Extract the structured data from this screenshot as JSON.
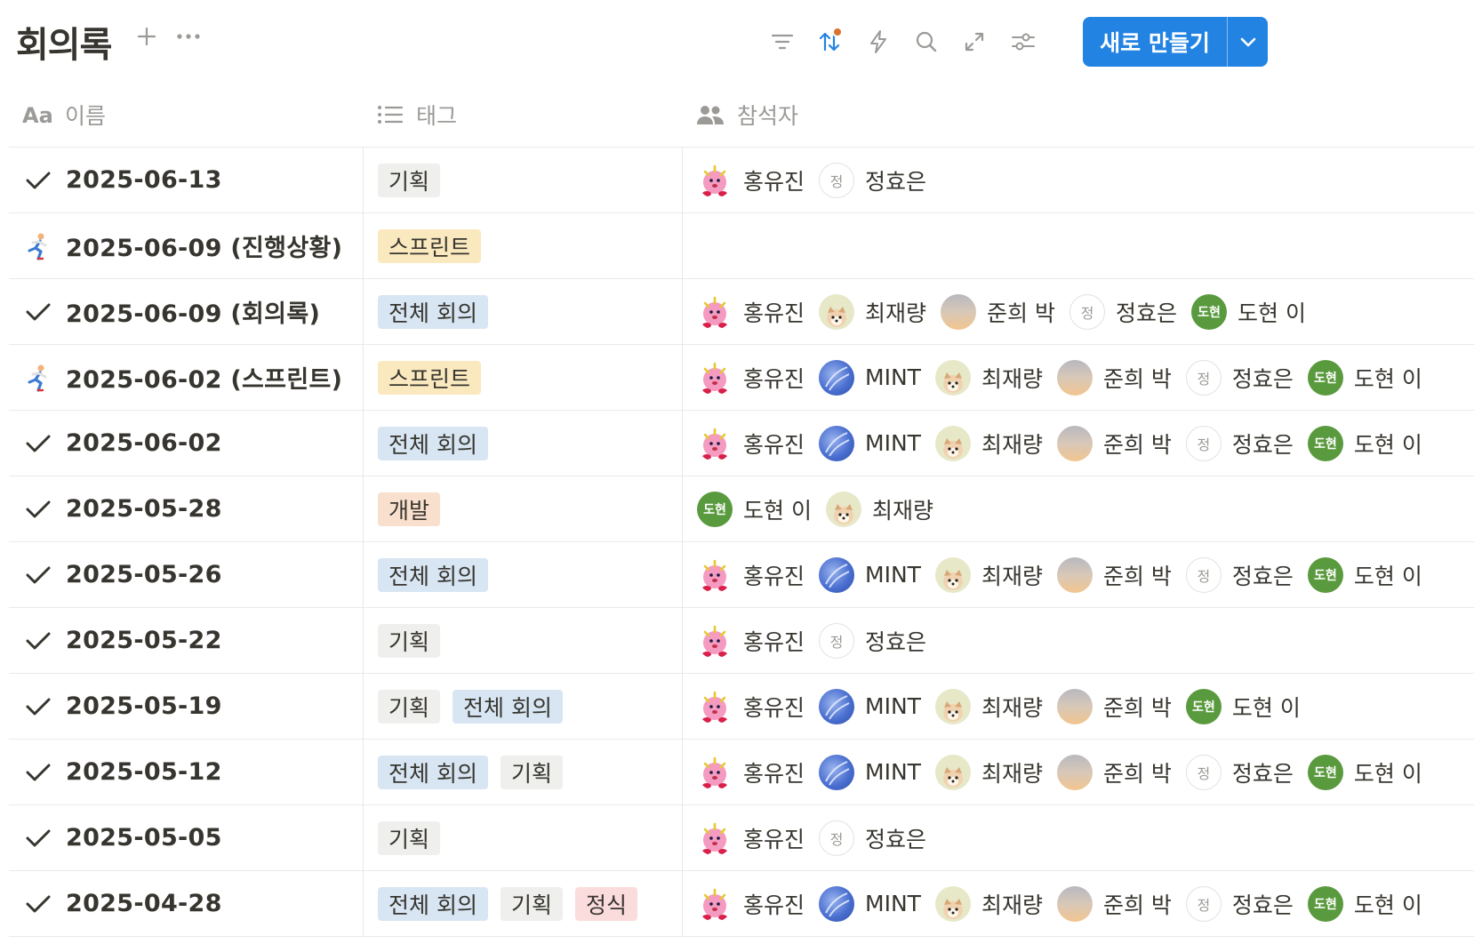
{
  "header": {
    "title": "회의록",
    "new_button_label": "새로 만들기",
    "toolbar_icons": [
      "filter-icon",
      "sort-icon",
      "automation-icon",
      "search-icon",
      "expand-icon",
      "settings-icon"
    ]
  },
  "columns": [
    {
      "label": "이름",
      "icon": "text-type-icon"
    },
    {
      "label": "태그",
      "icon": "list-icon"
    },
    {
      "label": "참석자",
      "icon": "people-icon"
    }
  ],
  "colors": {
    "accent": "#2383e2",
    "sort_badge": "#d9732c",
    "tag_planning": "#efefed",
    "tag_sprint": "#fae9bf",
    "tag_all_hands": "#d8e6f3",
    "tag_dev": "#f9dfcd",
    "tag_formal": "#fbdcdc"
  },
  "rows": [
    {
      "icon": "check",
      "name": "2025-06-13",
      "tags": [
        "기획"
      ],
      "people": [
        "홍유진",
        "정효은"
      ]
    },
    {
      "icon": "runner",
      "name": "2025-06-09 (진행상황)",
      "tags": [
        "스프린트"
      ],
      "people": []
    },
    {
      "icon": "check",
      "name": "2025-06-09 (회의록)",
      "tags": [
        "전체 회의"
      ],
      "people": [
        "홍유진",
        "최재량",
        "준희 박",
        "정효은",
        "도현 이"
      ]
    },
    {
      "icon": "runner",
      "name": "2025-06-02 (스프린트)",
      "tags": [
        "스프린트"
      ],
      "people": [
        "홍유진",
        "MINT",
        "최재량",
        "준희 박",
        "정효은",
        "도현 이"
      ]
    },
    {
      "icon": "check",
      "name": "2025-06-02",
      "tags": [
        "전체 회의"
      ],
      "people": [
        "홍유진",
        "MINT",
        "최재량",
        "준희 박",
        "정효은",
        "도현 이"
      ]
    },
    {
      "icon": "check",
      "name": "2025-05-28",
      "tags": [
        "개발"
      ],
      "people": [
        "도현 이",
        "최재량"
      ]
    },
    {
      "icon": "check",
      "name": "2025-05-26",
      "tags": [
        "전체 회의"
      ],
      "people": [
        "홍유진",
        "MINT",
        "최재량",
        "준희 박",
        "정효은",
        "도현 이"
      ]
    },
    {
      "icon": "check",
      "name": "2025-05-22",
      "tags": [
        "기획"
      ],
      "people": [
        "홍유진",
        "정효은"
      ]
    },
    {
      "icon": "check",
      "name": "2025-05-19",
      "tags": [
        "기획",
        "전체 회의"
      ],
      "people": [
        "홍유진",
        "MINT",
        "최재량",
        "준희 박",
        "도현 이"
      ]
    },
    {
      "icon": "check",
      "name": "2025-05-12",
      "tags": [
        "전체 회의",
        "기획"
      ],
      "people": [
        "홍유진",
        "MINT",
        "최재량",
        "준희 박",
        "정효은",
        "도현 이"
      ]
    },
    {
      "icon": "check",
      "name": "2025-05-05",
      "tags": [
        "기획"
      ],
      "people": [
        "홍유진",
        "정효은"
      ]
    },
    {
      "icon": "check",
      "name": "2025-04-28",
      "tags": [
        "전체 회의",
        "기획",
        "정식"
      ],
      "people": [
        "홍유진",
        "MINT",
        "최재량",
        "준희 박",
        "정효은",
        "도현 이"
      ]
    }
  ],
  "avatars": {
    "정효은": {
      "initial": "정"
    },
    "도현 이": {
      "initial": "도현"
    }
  }
}
